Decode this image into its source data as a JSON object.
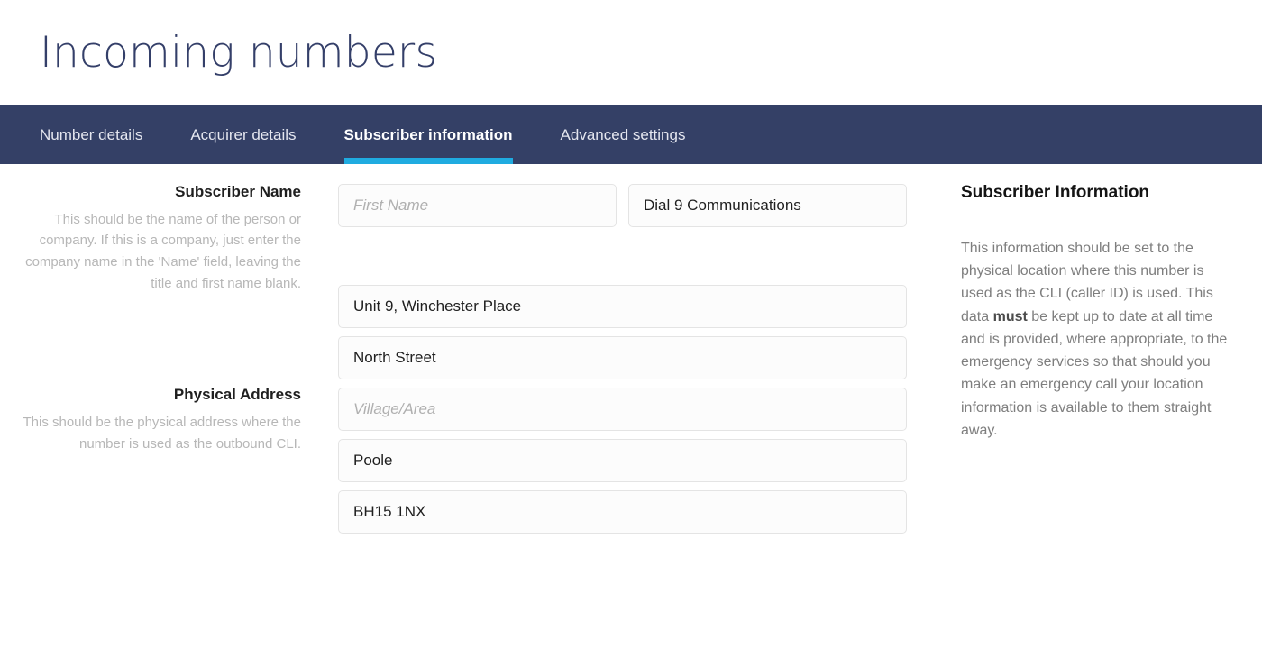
{
  "header": {
    "title": "Incoming numbers"
  },
  "tabs": [
    {
      "label": "Number details",
      "active": false
    },
    {
      "label": "Acquirer details",
      "active": false
    },
    {
      "label": "Subscriber information",
      "active": true
    },
    {
      "label": "Advanced settings",
      "active": false
    }
  ],
  "colors": {
    "navbar_background": "#344066",
    "active_tab_underline": "#1fabe0",
    "title_text": "#343f69",
    "help_text": "#b7b7b7",
    "aside_text": "#7e7e7e",
    "input_border": "#e4e4e4",
    "input_background": "#fcfcfc"
  },
  "form": {
    "subscriber_name": {
      "label": "Subscriber Name",
      "help": "This should be the name of the person or company. If this is a company, just enter the company name in the 'Name' field, leaving the title and first name blank.",
      "first_name": {
        "value": "",
        "placeholder": "First Name"
      },
      "last_name": {
        "value": "Dial 9 Communications",
        "placeholder": ""
      }
    },
    "physical_address": {
      "label": "Physical Address",
      "help": "This should be the physical address where the number is used as the outbound CLI.",
      "line1": {
        "value": "Unit 9, Winchester Place",
        "placeholder": ""
      },
      "line2": {
        "value": "North Street",
        "placeholder": ""
      },
      "line3": {
        "value": "",
        "placeholder": "Village/Area"
      },
      "town": {
        "value": "Poole",
        "placeholder": ""
      },
      "postcode": {
        "value": "BH15 1NX",
        "placeholder": ""
      }
    }
  },
  "aside": {
    "title": "Subscriber Information",
    "paragraph_part1": "This information should be set to the physical location where this number is used as the CLI (caller ID) is used. This data ",
    "paragraph_emphasis": "must",
    "paragraph_part2": " be kept up to date at all time and is provided, where appropriate, to the emergency services so that should you make an emergency call your location information is available to them straight away."
  }
}
